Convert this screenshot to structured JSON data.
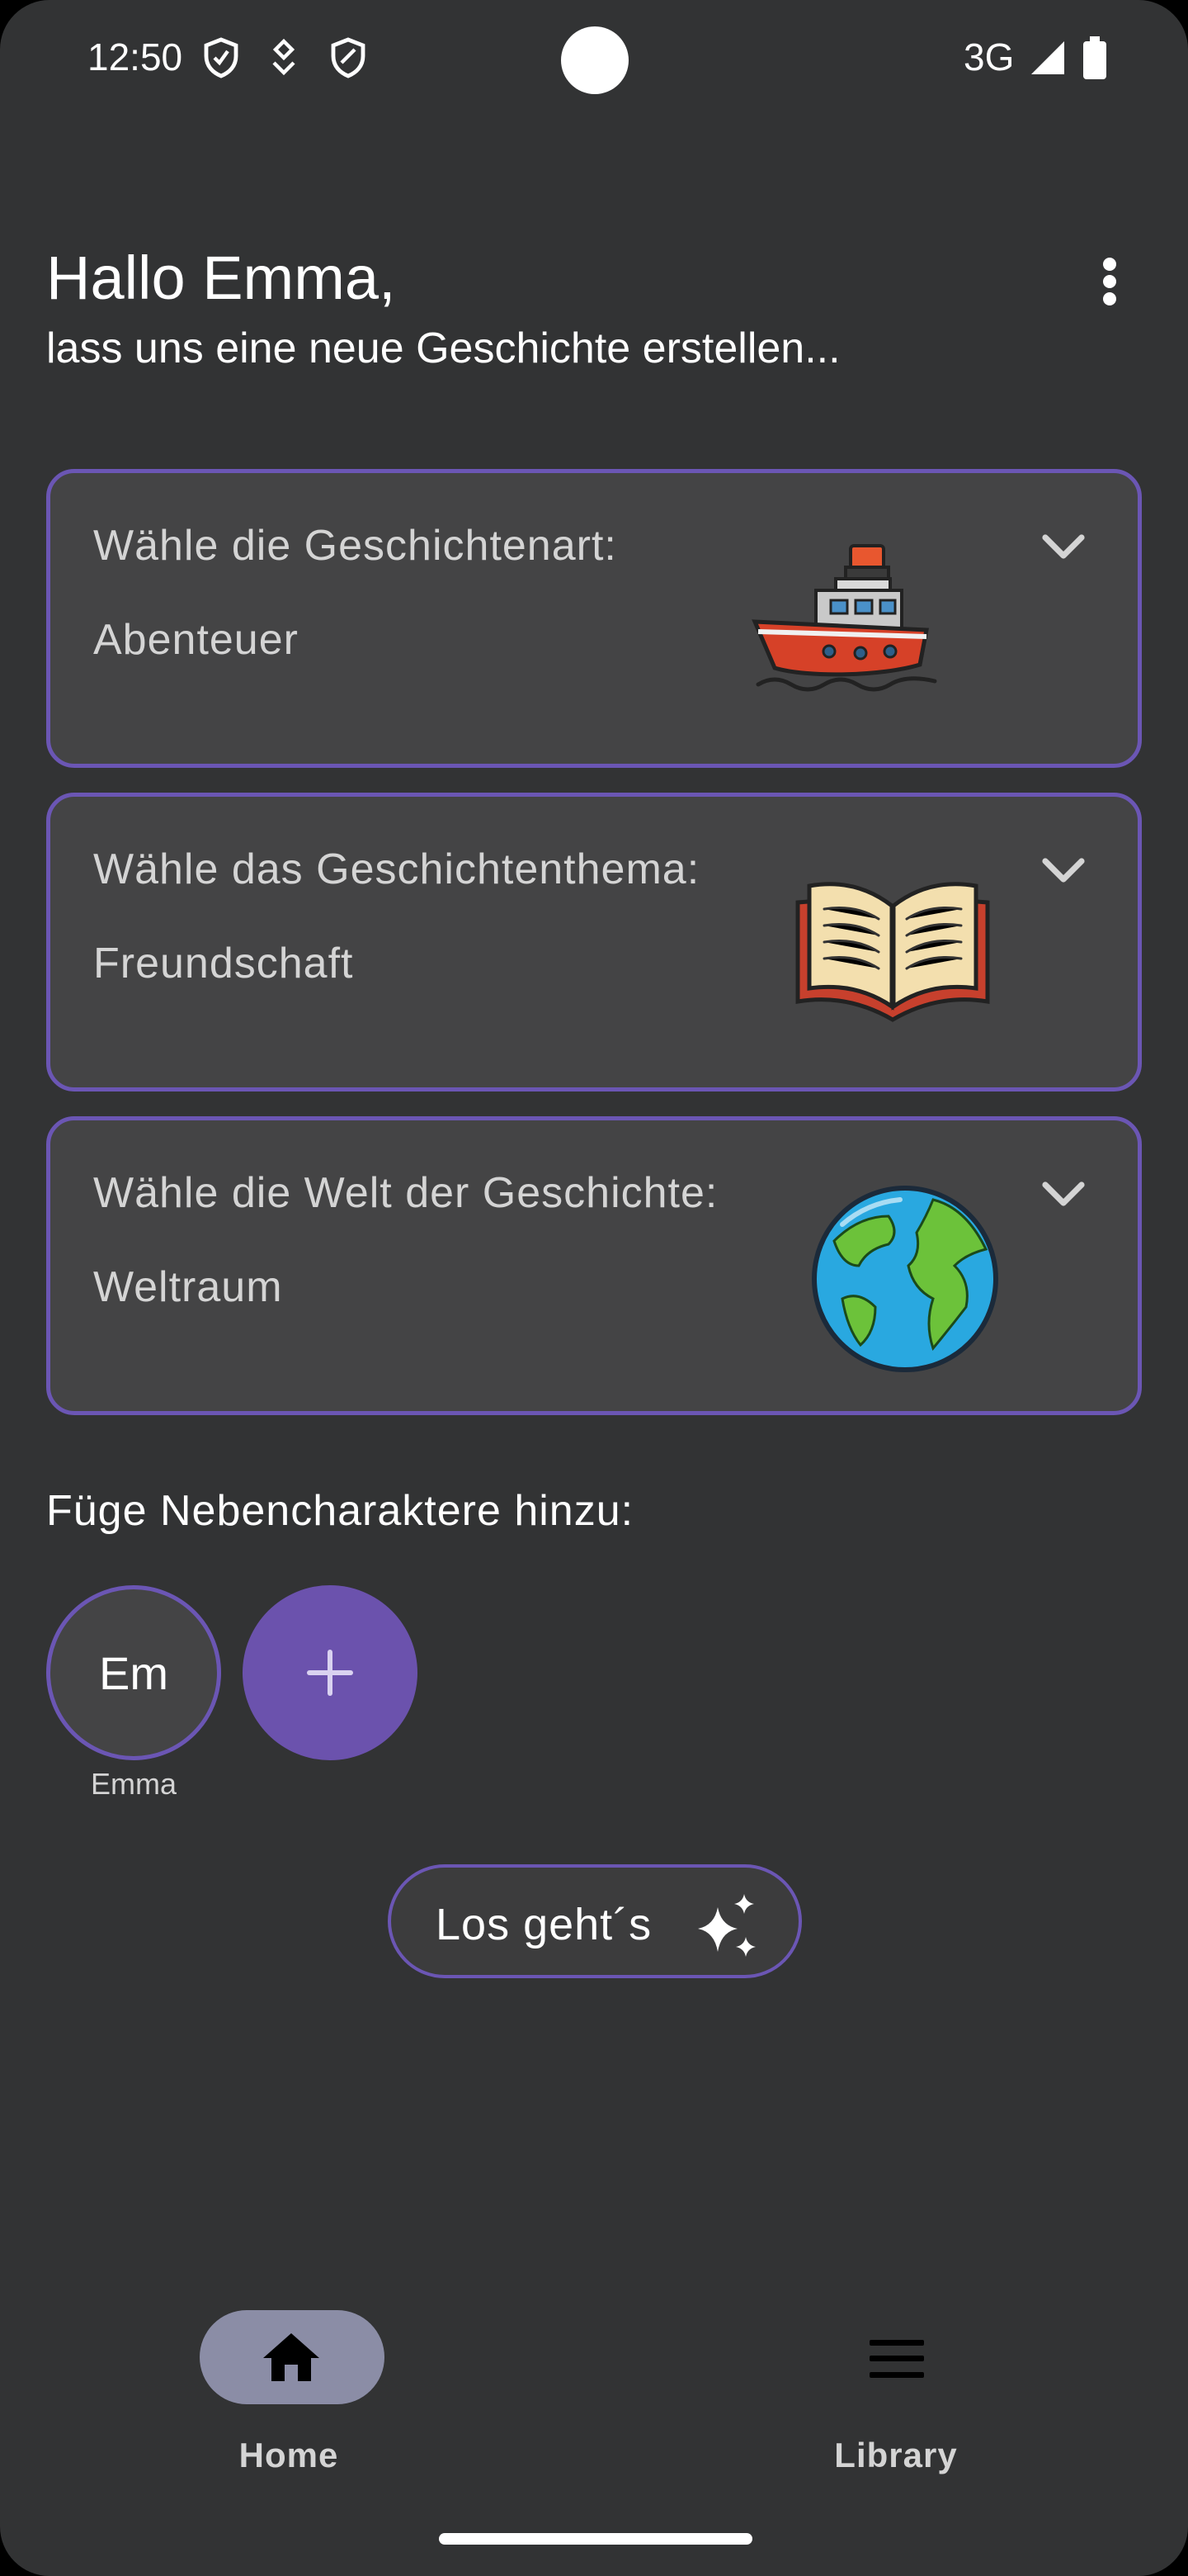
{
  "status_bar": {
    "time": "12:50",
    "network": "3G",
    "icons": [
      "shield-icon",
      "location-icon",
      "shield-icon",
      "signal-icon",
      "battery-icon"
    ]
  },
  "header": {
    "greeting": "Hallo Emma,",
    "subtitle": "lass uns eine neue Geschichte erstellen..."
  },
  "cards": [
    {
      "label": "Wähle die Geschichtenart:",
      "value": "Abenteuer",
      "icon": "ship-icon"
    },
    {
      "label": "Wähle das Geschichtenthema:",
      "value": "Freundschaft",
      "icon": "book-icon"
    },
    {
      "label": "Wähle die Welt der Geschichte:",
      "value": "Weltraum",
      "icon": "globe-icon"
    }
  ],
  "characters": {
    "label": "Füge Nebencharaktere hinzu:",
    "items": [
      {
        "initials": "Em",
        "name": "Emma"
      }
    ]
  },
  "start_button": {
    "label": "Los geht´s"
  },
  "bottom_nav": {
    "items": [
      {
        "label": "Home",
        "icon": "home-icon",
        "active": true
      },
      {
        "label": "Library",
        "icon": "list-icon",
        "active": false
      }
    ]
  },
  "colors": {
    "background": "#323334",
    "card": "#444445",
    "accent": "#6b56b4",
    "fab": "#6b52ad",
    "nav_active": "#8b8da6"
  }
}
